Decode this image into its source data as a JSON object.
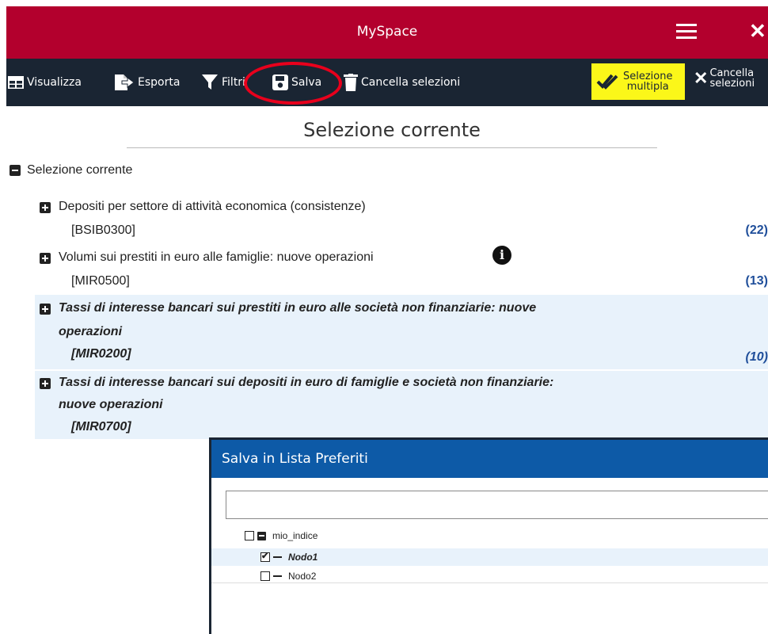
{
  "app": {
    "title": "MySpace"
  },
  "toolbar": {
    "visualizza": "Visualizza",
    "esporta": "Esporta",
    "filtri": "Filtri",
    "salva": "Salva",
    "cancella": "Cancella selezioni",
    "selezione_multipla_line1": "Selezione",
    "selezione_multipla_line2": "multipla",
    "cancella_selezioni_line1": "Cancella",
    "cancella_selezioni_line2": "selezioni"
  },
  "main": {
    "heading": "Selezione corrente",
    "root_label": "Selezione corrente",
    "items": [
      {
        "title": "Depositi per settore di attività economica (consistenze)",
        "code": "[BSIB0300]",
        "count": "(22)",
        "selected": false
      },
      {
        "title": "Volumi sui prestiti in euro alle famiglie: nuove operazioni",
        "code": "[MIR0500]",
        "count": "(13)",
        "selected": false
      },
      {
        "title_line1": "Tassi di interesse bancari sui prestiti in euro alle società non finanziarie: nuove",
        "title_line2": "operazioni",
        "code": "[MIR0200]",
        "count": "(10)",
        "selected": true
      },
      {
        "title_line1": "Tassi di interesse bancari sui depositi in euro di famiglie e società non finanziarie:",
        "title_line2": "nuove operazioni",
        "code": "[MIR0700]",
        "count": "",
        "selected": true
      }
    ]
  },
  "dialog": {
    "title": "Salva in Lista Preferiti",
    "input_value": "",
    "tree": [
      {
        "label": "mio_indice",
        "checked": false,
        "level": 0
      },
      {
        "label": "Nodo1",
        "checked": true,
        "level": 1
      },
      {
        "label": "Nodo2",
        "checked": false,
        "level": 1
      }
    ]
  },
  "colors": {
    "titlebar": "#b3002d",
    "toolbar": "#1a2533",
    "dialog_header": "#0d5aa7",
    "highlight": "#fbf719",
    "selected_row": "#e8f2fb",
    "ring": "#e8001c"
  }
}
